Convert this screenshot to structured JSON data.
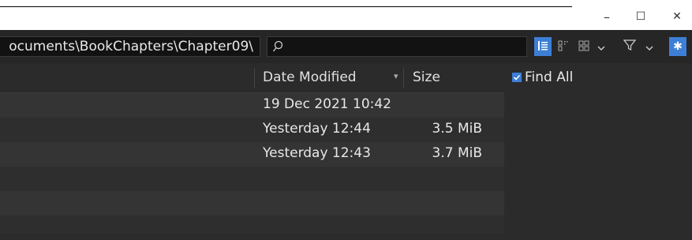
{
  "window": {
    "minimize_glyph": "–",
    "maximize_glyph": "☐",
    "close_glyph": "✕"
  },
  "toolbar": {
    "path": "ocuments\\BookChapters\\Chapter09\\",
    "search_placeholder": "",
    "view_buttons": [
      "details-view-icon",
      "thumbnails-view-icon",
      "grid-view-icon"
    ],
    "filter_icon": "filter-icon",
    "settings_icon": "gear-icon",
    "accent": "#3d7fd6"
  },
  "list": {
    "columns": [
      "Date Modified",
      "Size"
    ],
    "sort_indicator": "▾",
    "rows": [
      {
        "date": "19 Dec 2021 10:42",
        "size": ""
      },
      {
        "date": "Yesterday 12:44",
        "size": "3.5 MiB"
      },
      {
        "date": "Yesterday 12:43",
        "size": "3.7 MiB"
      },
      {
        "date": "",
        "size": ""
      },
      {
        "date": "",
        "size": ""
      },
      {
        "date": "",
        "size": ""
      }
    ]
  },
  "right_panel": {
    "find_all_label": "Find All",
    "find_all_checked": true
  }
}
